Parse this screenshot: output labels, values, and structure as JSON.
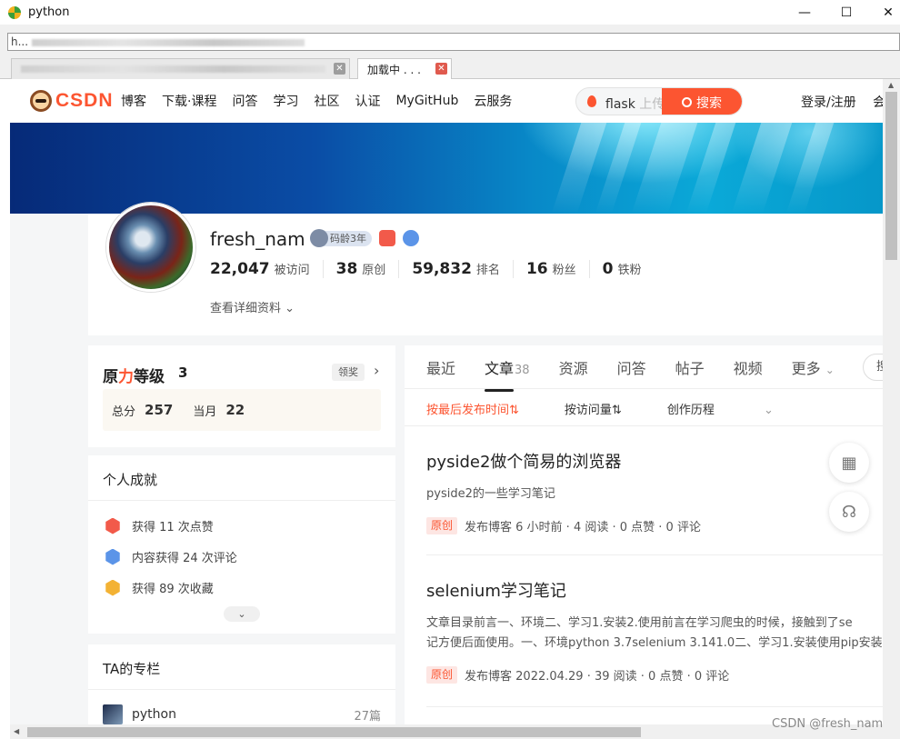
{
  "window": {
    "title": "python",
    "minimize_glyph": "—",
    "maximize_glyph": "☐",
    "close_glyph": "✕"
  },
  "address_bar": {
    "visible_prefix": "h..."
  },
  "tabs": [
    {
      "label": "",
      "state": "inactive"
    },
    {
      "label": "加载中 . . .",
      "state": "active"
    }
  ],
  "nav": {
    "brand": "CSDN",
    "links": [
      "博客",
      "下载·课程",
      "问答",
      "学习",
      "社区",
      "认证",
      "MyGitHub",
      "云服务"
    ],
    "search_query": "flask",
    "search_placeholder": "上传",
    "search_button": "搜索",
    "login": "登录/注册",
    "overflow": "会"
  },
  "profile": {
    "username": "fresh_nam",
    "code_age_badge": "码龄3年",
    "stats": [
      {
        "value": "22,047",
        "label": "被访问"
      },
      {
        "value": "38",
        "label": "原创"
      },
      {
        "value": "59,832",
        "label": "排名"
      },
      {
        "value": "16",
        "label": "粉丝"
      },
      {
        "value": "0",
        "label": "铁粉"
      }
    ],
    "detail_link": "查看详细资料"
  },
  "level_card": {
    "title_prefix": "原",
    "title_red": "力",
    "title_suffix": "等级",
    "level": "3",
    "award_button": "领奖",
    "total_label": "总分",
    "total_value": "257",
    "month_label": "当月",
    "month_value": "22"
  },
  "achievements": {
    "title": "个人成就",
    "items": [
      {
        "text": "获得 11 次点赞",
        "icon": "like-badge-icon",
        "color": "#f25a4a"
      },
      {
        "text": "内容获得 24 次评论",
        "icon": "comment-badge-icon",
        "color": "#5b94e8"
      },
      {
        "text": "获得 89 次收藏",
        "icon": "favorite-badge-icon",
        "color": "#f3b234"
      }
    ]
  },
  "columns": {
    "title": "TA的专栏",
    "items": [
      {
        "name": "python",
        "count": "27篇"
      }
    ]
  },
  "content_tabs": {
    "items": [
      "最近",
      "文章",
      "资源",
      "问答",
      "帖子",
      "视频",
      "更多"
    ],
    "article_count": "38",
    "active": "文章",
    "pill_text": "搜"
  },
  "sort": [
    "按最后发布时间⇅",
    "按访问量⇅",
    "创作历程"
  ],
  "articles": [
    {
      "title": "pyside2做个简易的浏览器",
      "desc": [
        "pyside2的一些学习笔记"
      ],
      "tag": "原创",
      "meta": "发布博客 6 小时前 · 4 阅读 · 0 点赞 · 0 评论"
    },
    {
      "title": "selenium学习笔记",
      "desc": [
        "文章目录前言一、环境二、学习1.安装2.使用前言在学习爬虫的时候，接触到了se",
        "记方便后面使用。一、环境python 3.7selenium 3.141.0二、学习1.安装使用pip安装"
      ],
      "tag": "原创",
      "meta": "发布博客 2022.04.29 · 39 阅读 · 0 点赞 · 0 评论"
    }
  ],
  "watermark": "CSDN @fresh_nam",
  "colors": {
    "accent": "#fc5531",
    "text": "#222222",
    "page_bg": "#f5f6f7"
  }
}
